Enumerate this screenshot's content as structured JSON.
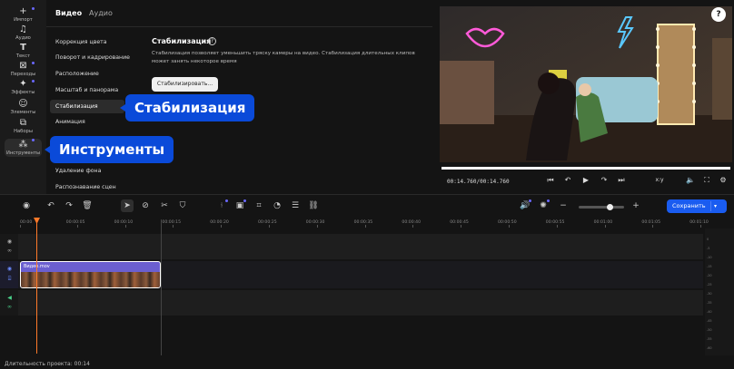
{
  "rail": [
    {
      "label": "Импорт",
      "icon": "plus-icon",
      "dot": true
    },
    {
      "label": "Аудио",
      "icon": "music-note-icon",
      "dot": false
    },
    {
      "label": "Текст",
      "icon": "text-icon",
      "dot": false
    },
    {
      "label": "Переходы",
      "icon": "transitions-icon",
      "dot": true
    },
    {
      "label": "Эффекты",
      "icon": "sparkle-icon",
      "dot": true
    },
    {
      "label": "Элементы",
      "icon": "elements-icon",
      "dot": false
    },
    {
      "label": "Наборы",
      "icon": "sets-icon",
      "dot": false
    },
    {
      "label": "Инструменты",
      "icon": "tools-icon",
      "dot": true
    }
  ],
  "tabs": {
    "video": "Видео",
    "audio": "Аудио"
  },
  "menu": [
    "Коррекция цвета",
    "Поворот и кадрирование",
    "Расположение",
    "Масштаб и панорама",
    "Стабилизация",
    "Анимация",
    "",
    "",
    "Удаление фона",
    "Распознавание сцен"
  ],
  "stabilization": {
    "title": "Стабилизация",
    "description": "Стабилизация позволяет уменьшить тряску камеры на видео. Стабилизация длительных клипов может занять некоторое время",
    "button": "Стабилизировать..."
  },
  "callouts": {
    "stabilization": "Стабилизация",
    "tools": "Инструменты"
  },
  "player": {
    "time": "00:14.760/00:14.760",
    "aspect": "x:y",
    "progress": 1.0
  },
  "toolbar": {
    "save": "Сохранить",
    "zoom": 0.62
  },
  "ruler": [
    "00:00",
    "00:00:05",
    "00:00:10",
    "00:00:15",
    "00:00:20",
    "00:00:25",
    "00:00:30",
    "00:00:35",
    "00:00:40",
    "00:00:45",
    "00:00:50",
    "00:00:55",
    "00:01:00",
    "00:01:05",
    "00:01:10"
  ],
  "clip": {
    "name": "Видео.mov"
  },
  "meter": [
    "0",
    "-5",
    "-10",
    "-15",
    "-20",
    "-25",
    "-30",
    "-35",
    "-40",
    "-45",
    "-50",
    "-55",
    "-60"
  ],
  "status": "Длительность проекта: 00:14",
  "colors": {
    "accent": "#1a5cf0",
    "callout": "#0a4ad9",
    "playhead": "#ff7a2a",
    "clip": "#6b5fd0"
  }
}
